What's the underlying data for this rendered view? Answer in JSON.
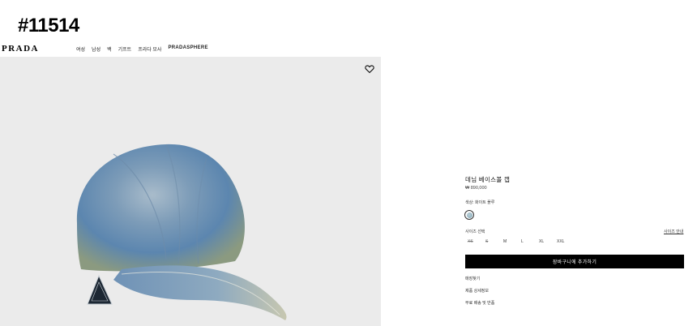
{
  "item_code": "#11514",
  "brand": "PRADA",
  "nav": [
    "여성",
    "남성",
    "백",
    "기프트",
    "프라다 모사",
    "PRADASPHERE"
  ],
  "product": {
    "name": "데님 베이스볼 캡",
    "price": "₩ 890,000",
    "color_label": "색상: 화이트 플루",
    "size_label": "사이즈 선택",
    "size_guide": "사이즈 안내",
    "sizes": [
      {
        "label": "XS",
        "available": false
      },
      {
        "label": "S",
        "available": false
      },
      {
        "label": "M",
        "available": true
      },
      {
        "label": "L",
        "available": true
      },
      {
        "label": "XL",
        "available": true
      },
      {
        "label": "XXL",
        "available": true
      }
    ],
    "add_to_cart": "장바구니에 추가하기",
    "links": [
      "매장찾기",
      "제품 상세정보",
      "무료 배송 및 반품"
    ]
  },
  "icons": {
    "favorite": "heart-icon",
    "swatch_color": "#8fb0c0"
  }
}
